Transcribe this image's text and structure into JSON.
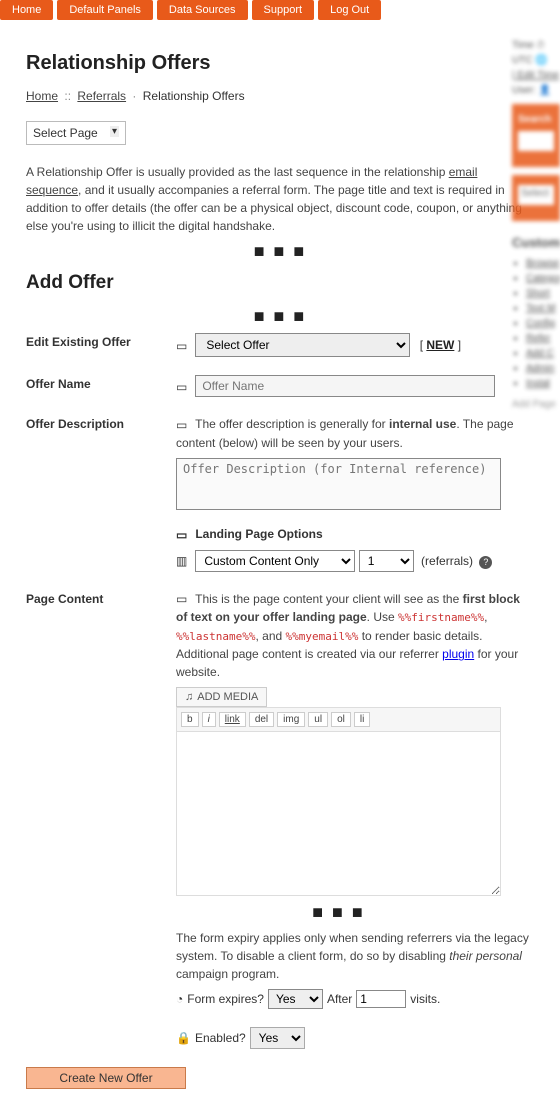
{
  "nav": {
    "items": [
      "Home",
      "Default Panels",
      "Data Sources",
      "Support",
      "Log Out"
    ]
  },
  "page_title": "Relationship Offers",
  "breadcrumbs": {
    "home": "Home",
    "referrals": "Referrals",
    "current": "Relationship Offers"
  },
  "select_page_label": "Select Page",
  "intro_before": "A Relationship Offer is usually provided as the last sequence in the relationship ",
  "intro_link": "email sequence",
  "intro_after": ", and it usually accompanies a referral form. The page title and text is required in addition to offer details (the offer can be a physical object, discount code, coupon, or anything else you're using to illicit the digital handshake.",
  "add_offer_title": "Add Offer",
  "labels": {
    "edit_existing": "Edit Existing Offer",
    "offer_name": "Offer Name",
    "offer_desc": "Offer Description",
    "landing_head": "Landing Page Options",
    "page_content": "Page Content",
    "form_expires": "Form expires?",
    "after": "After",
    "visits": "visits.",
    "enabled": "Enabled?"
  },
  "existing": {
    "select_first": "Select Offer",
    "new_label": "NEW"
  },
  "name_placeholder": "Offer Name",
  "desc_hint_before": "The offer description is generally for ",
  "desc_hint_bold": "internal use",
  "desc_hint_after": ". The page content (below) will be seen by your users.",
  "desc_placeholder": "Offer Description (for Internal reference)",
  "landing": {
    "content_mode": "Custom Content Only",
    "ref_count": "1",
    "ref_label": "(referrals)"
  },
  "pagecontent_hint": {
    "a": "This is the page content your client will see as the ",
    "b": "first block of text on your offer landing page",
    "c": ". Use ",
    "t1": "%%firstname%%",
    "comma": ", ",
    "t2": "%%lastname%%",
    "and": ", and ",
    "t3": "%%myemail%%",
    "d": " to render basic details. Additional page content is created via our referrer ",
    "plugin": "plugin",
    "e": " for your website."
  },
  "editor": {
    "add_media": "ADD MEDIA",
    "btns": [
      "b",
      "i",
      "link",
      "del",
      "img",
      "ul",
      "ol",
      "li"
    ]
  },
  "expiry_hint_a": "The form expiry applies only when sending referrers via the legacy system. To disable a client form, do so by disabling ",
  "expiry_hint_i": "their personal",
  "expiry_hint_b": " campaign program.",
  "expiry": {
    "yes": "Yes",
    "count": "1"
  },
  "enabled_val": "Yes",
  "submit_label": "Create New Offer",
  "rside": {
    "meta": [
      "Time  ⏱",
      "UTC  🌐",
      "| Edit Time",
      "User:  👤"
    ],
    "search_lbl": "Search",
    "select_lbl": "Select",
    "custom_head": "Custom",
    "links": [
      "Browse",
      "Categories",
      "Short",
      "Text M",
      "Config",
      "Refer",
      "Add C",
      "Admin",
      "Instal"
    ],
    "addpage": "Add Page"
  }
}
